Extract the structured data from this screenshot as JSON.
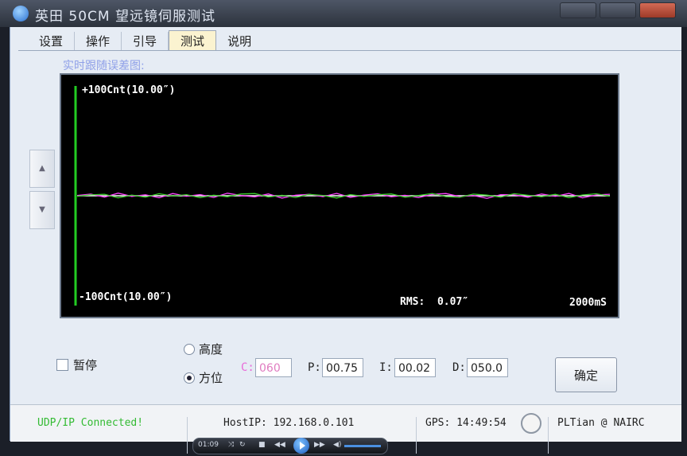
{
  "window": {
    "title": "英田 50CM 望远镜伺服测试"
  },
  "tabs": [
    {
      "label": "设置",
      "active": false
    },
    {
      "label": "操作",
      "active": false
    },
    {
      "label": "引导",
      "active": false
    },
    {
      "label": "测试",
      "active": true
    },
    {
      "label": "说明",
      "active": false
    }
  ],
  "plot": {
    "label": "实时跟随误差图:",
    "max_label": "+100Cnt(10.00″)",
    "min_label": "-100Cnt(10.00″)",
    "rms_label": "RMS:",
    "rms_value": "0.07″",
    "timespan": "2000mS"
  },
  "chart_data": {
    "type": "line",
    "ylim": [
      -100,
      100
    ],
    "series": [
      {
        "color": "#ff40ff",
        "values": [
          0.3,
          1.5,
          -1.2,
          2.4,
          -0.6,
          0.9,
          -1.8,
          2.0,
          -0.4,
          1.1,
          -1.5,
          2.3,
          0.2,
          -1.0,
          1.7,
          -2.1,
          0.5,
          1.3,
          -0.8,
          2.2,
          -1.4,
          0.6,
          1.8,
          -0.9,
          0.4,
          -1.6,
          1.2,
          2.0,
          -0.7,
          0.3,
          -2.3,
          1.0,
          0.8,
          -1.3,
          1.6,
          -0.5,
          2.1,
          -1.9,
          0.7,
          1.4
        ]
      },
      {
        "color": "#3cd02c",
        "values": [
          -0.5,
          0.8,
          1.4,
          -1.9,
          0.6,
          -1.2,
          1.9,
          -0.3,
          1.0,
          -1.7,
          0.5,
          -0.9,
          1.6,
          2.0,
          -1.1,
          0.4,
          -1.5,
          1.2,
          0.3,
          -2.0,
          1.1,
          -0.6,
          0.9,
          1.7,
          -1.3,
          0.2,
          2.1,
          -0.8,
          -1.4,
          1.5,
          0.6,
          -1.2,
          1.9,
          0.4,
          -0.9,
          1.3,
          -1.7,
          0.7,
          1.8,
          -0.4
        ]
      }
    ]
  },
  "controls": {
    "pause_label": "暂停",
    "radio_height": "高度",
    "radio_azimuth": "方位",
    "c_label": "C:",
    "c_value": "060",
    "p_label": "P:",
    "p_value": "00.75",
    "i_label": "I:",
    "i_value": "00.02",
    "d_label": "D:",
    "d_value": "050.0",
    "ok_label": "确定"
  },
  "status": {
    "connection": "UDP/IP Connected!",
    "host_ip": "HostIP: 192.168.0.101",
    "gps": "GPS: 14:49:54",
    "credit": "PLTian @ NAIRC"
  },
  "player": {
    "time": "01:09"
  },
  "colors": {
    "plot_bg": "#000000",
    "y_axis": "#22cc22",
    "tab_active": "#fbf3d0",
    "connected_text": "#33bb33",
    "c_label": "#e86ad8"
  }
}
